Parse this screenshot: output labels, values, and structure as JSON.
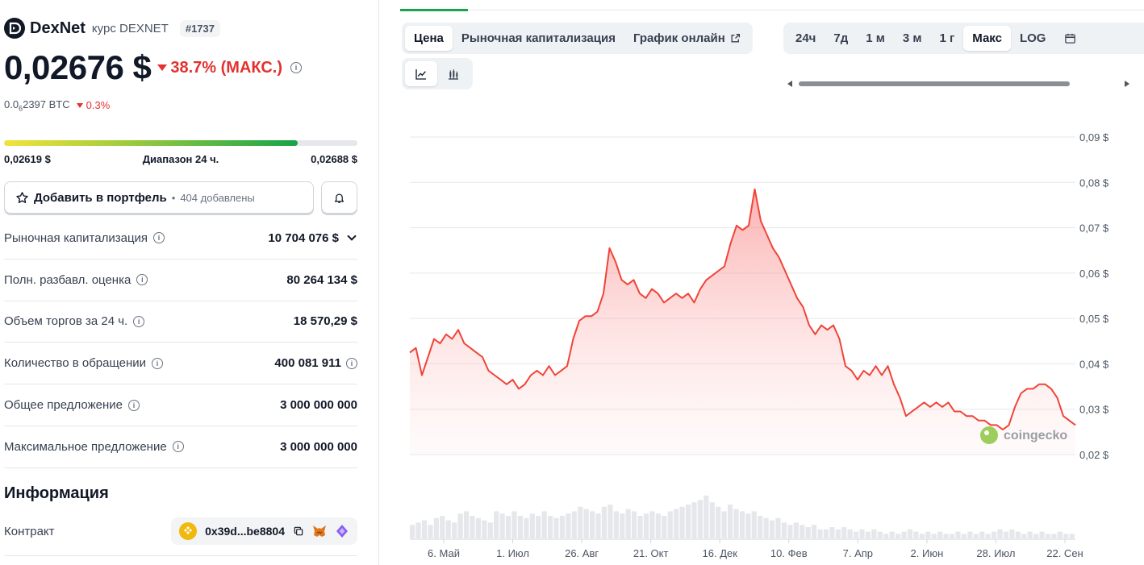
{
  "coin": {
    "name": "DexNet",
    "subtitle": "курс DEXNET",
    "rank": "#1737",
    "price": "0,02676 $",
    "change": "38.7% (МАКС.)",
    "btc_price_prefix": "0.0",
    "btc_price_sub": "6",
    "btc_price_rest": "2397 BTC",
    "btc_change": "0.3%"
  },
  "range": {
    "low": "0,02619 $",
    "label": "Диапазон 24 ч.",
    "high": "0,02688 $",
    "position_fraction": 0.83
  },
  "portfolio": {
    "label": "Добавить в портфель",
    "separator": "•",
    "count": "404 добавлены"
  },
  "stats": [
    {
      "label": "Рыночная капитализация",
      "value": "10 704 076 $",
      "expand": true
    },
    {
      "label": "Полн. разбавл. оценка",
      "value": "80 264 134 $"
    },
    {
      "label": "Объем торгов за 24 ч.",
      "value": "18 570,29 $"
    },
    {
      "label": "Количество в обращении",
      "value": "400 081 911",
      "value_info": true
    },
    {
      "label": "Общее предложение",
      "value": "3 000 000 000"
    },
    {
      "label": "Максимальное предложение",
      "value": "3 000 000 000"
    }
  ],
  "info": {
    "title": "Информация",
    "contract_label": "Контракт",
    "contract_address": "0x39d...be8804"
  },
  "chart_tabs": {
    "items": [
      "Цена",
      "Рыночная капитализация",
      "График онлайн"
    ],
    "active": "Цена"
  },
  "range_tabs": {
    "items": [
      "24ч",
      "7д",
      "1 м",
      "3 м",
      "1 г",
      "Макс",
      "LOG"
    ],
    "active": "Макс"
  },
  "chart_type_icons": [
    "line-chart-icon",
    "candlestick-chart-icon"
  ],
  "watermark": "coingecko",
  "colors": {
    "accent_green": "#16a34a",
    "negative_red": "#e2322f",
    "chart_line": "#f04438"
  },
  "chart_data": {
    "type": "area",
    "title": "",
    "xlabel": "",
    "ylabel": "",
    "x_tick_labels": [
      "6. Май",
      "1. Июл",
      "26. Авг",
      "21. Окт",
      "16. Дек",
      "10. Фев",
      "7. Апр",
      "2. Июн",
      "28. Июл",
      "22. Сен"
    ],
    "y_tick_labels": [
      "0,09 $",
      "0,08 $",
      "0,07 $",
      "0,06 $",
      "0,05 $",
      "0,04 $",
      "0,03 $",
      "0,02 $"
    ],
    "y_ticks": [
      0.09,
      0.08,
      0.07,
      0.06,
      0.05,
      0.04,
      0.03,
      0.02
    ],
    "ylim": [
      0.02,
      0.09
    ],
    "grid": true,
    "series": [
      {
        "values": [
          0.0425,
          0.0435,
          0.0375,
          0.0415,
          0.0455,
          0.0445,
          0.0465,
          0.0455,
          0.0475,
          0.0445,
          0.0435,
          0.0425,
          0.0415,
          0.0385,
          0.0375,
          0.0365,
          0.0355,
          0.0365,
          0.0345,
          0.0355,
          0.0375,
          0.0385,
          0.0375,
          0.0395,
          0.0375,
          0.0385,
          0.0395,
          0.0455,
          0.0495,
          0.0505,
          0.0505,
          0.0515,
          0.0555,
          0.0655,
          0.0625,
          0.0585,
          0.0575,
          0.0585,
          0.0555,
          0.0545,
          0.0565,
          0.0555,
          0.0535,
          0.0545,
          0.0555,
          0.0545,
          0.0555,
          0.0535,
          0.0565,
          0.0585,
          0.0595,
          0.0605,
          0.0615,
          0.0665,
          0.0705,
          0.0695,
          0.0705,
          0.0785,
          0.0715,
          0.0685,
          0.0655,
          0.0635,
          0.0605,
          0.0575,
          0.0545,
          0.0525,
          0.0485,
          0.0465,
          0.0485,
          0.0475,
          0.0485,
          0.0455,
          0.0395,
          0.0385,
          0.0365,
          0.0385,
          0.0375,
          0.0395,
          0.0375,
          0.0395,
          0.0355,
          0.0325,
          0.0285,
          0.0295,
          0.0305,
          0.0315,
          0.0305,
          0.0315,
          0.0305,
          0.0315,
          0.0295,
          0.0295,
          0.0285,
          0.0285,
          0.0275,
          0.0275,
          0.0265,
          0.0265,
          0.0255,
          0.0265,
          0.0305,
          0.0335,
          0.0345,
          0.0345,
          0.0355,
          0.0355,
          0.0345,
          0.0325,
          0.0285,
          0.0275,
          0.0265
        ]
      }
    ],
    "volume": {
      "type": "bar",
      "description_values": "relative volume per period",
      "values": [
        0.3,
        0.35,
        0.4,
        0.3,
        0.45,
        0.5,
        0.4,
        0.35,
        0.55,
        0.6,
        0.5,
        0.45,
        0.4,
        0.35,
        0.6,
        0.55,
        0.5,
        0.6,
        0.5,
        0.45,
        0.55,
        0.5,
        0.6,
        0.5,
        0.45,
        0.5,
        0.55,
        0.6,
        0.7,
        0.65,
        0.6,
        0.55,
        0.7,
        0.75,
        0.6,
        0.55,
        0.65,
        0.6,
        0.5,
        0.55,
        0.6,
        0.55,
        0.5,
        0.6,
        0.65,
        0.7,
        0.75,
        0.8,
        0.85,
        0.95,
        0.8,
        0.7,
        0.6,
        0.75,
        0.65,
        0.6,
        0.55,
        0.6,
        0.5,
        0.45,
        0.4,
        0.45,
        0.35,
        0.3,
        0.35,
        0.3,
        0.25,
        0.3,
        0.2,
        0.2,
        0.25,
        0.2,
        0.25,
        0.2,
        0.15,
        0.2,
        0.15,
        0.2,
        0.15,
        0.1,
        0.15,
        0.1,
        0.15,
        0.2,
        0.15,
        0.1,
        0.15,
        0.1,
        0.15,
        0.1,
        0.1,
        0.15,
        0.1,
        0.15,
        0.1,
        0.15,
        0.1,
        0.15,
        0.2,
        0.15,
        0.2,
        0.15,
        0.1,
        0.15,
        0.1,
        0.15,
        0.1,
        0.1,
        0.15,
        0.1,
        0.1
      ]
    }
  }
}
